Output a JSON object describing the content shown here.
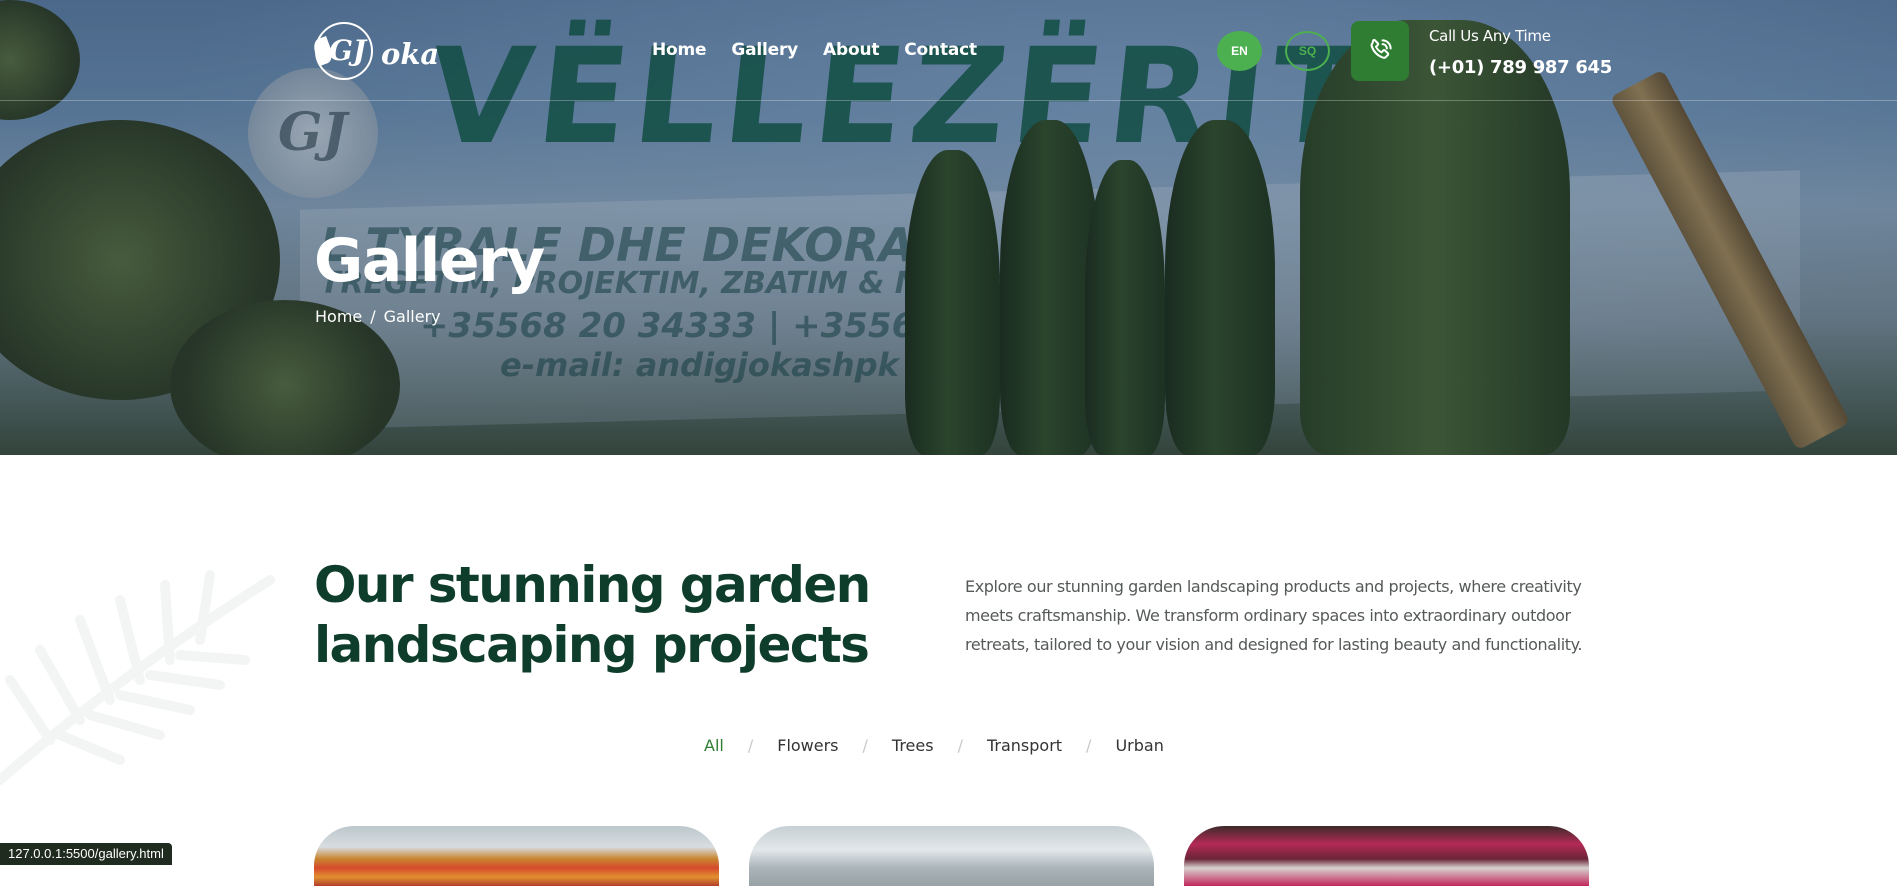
{
  "header": {
    "logo": {
      "word": "oka",
      "monogram": "GJ"
    },
    "nav": [
      {
        "label": "Home"
      },
      {
        "label": "Gallery"
      },
      {
        "label": "About"
      },
      {
        "label": "Contact"
      }
    ],
    "languages": {
      "en": "EN",
      "sq": "SQ",
      "active": "EN"
    },
    "call": {
      "label": "Call Us Any Time",
      "number": "(+01) 789 987 645",
      "icon": "phone-icon"
    }
  },
  "hero": {
    "title": "Gallery",
    "breadcrumb": {
      "home": "Home",
      "separator": "/",
      "current": "Gallery"
    },
    "background_sign": {
      "main": "VËLLEZËRIT G",
      "line1": "L  TYRALE DHE DEKORATI",
      "line2": "TREGETIM, PROJEKTIM, ZBATIM & MIRËMB",
      "line3": "+35568 20 34333 | +3556830 41",
      "line4": "e-mail: andigjokashpk @"
    }
  },
  "intro": {
    "heading": "Our stunning garden landscaping projects",
    "description": "Explore our stunning garden landscaping products and projects, where creativity meets craftsmanship. We transform ordinary spaces into extraordinary outdoor retreats, tailored to your vision and designed for lasting beauty and functionality."
  },
  "filters": {
    "items": [
      {
        "label": "All",
        "active": true
      },
      {
        "label": "Flowers",
        "active": false
      },
      {
        "label": "Trees",
        "active": false
      },
      {
        "label": "Transport",
        "active": false
      },
      {
        "label": "Urban",
        "active": false
      }
    ],
    "separator": "/"
  },
  "gallery": {
    "cards": [
      {
        "name": "gallery-card-1"
      },
      {
        "name": "gallery-card-2"
      },
      {
        "name": "gallery-card-3"
      }
    ]
  },
  "status_bar": {
    "url": "127.0.0.1:5500/gallery.html"
  },
  "colors": {
    "accent": "#4caf50",
    "accent_dark": "#2e7d32",
    "heading": "#0f3d2c",
    "body_text": "#555a58"
  }
}
